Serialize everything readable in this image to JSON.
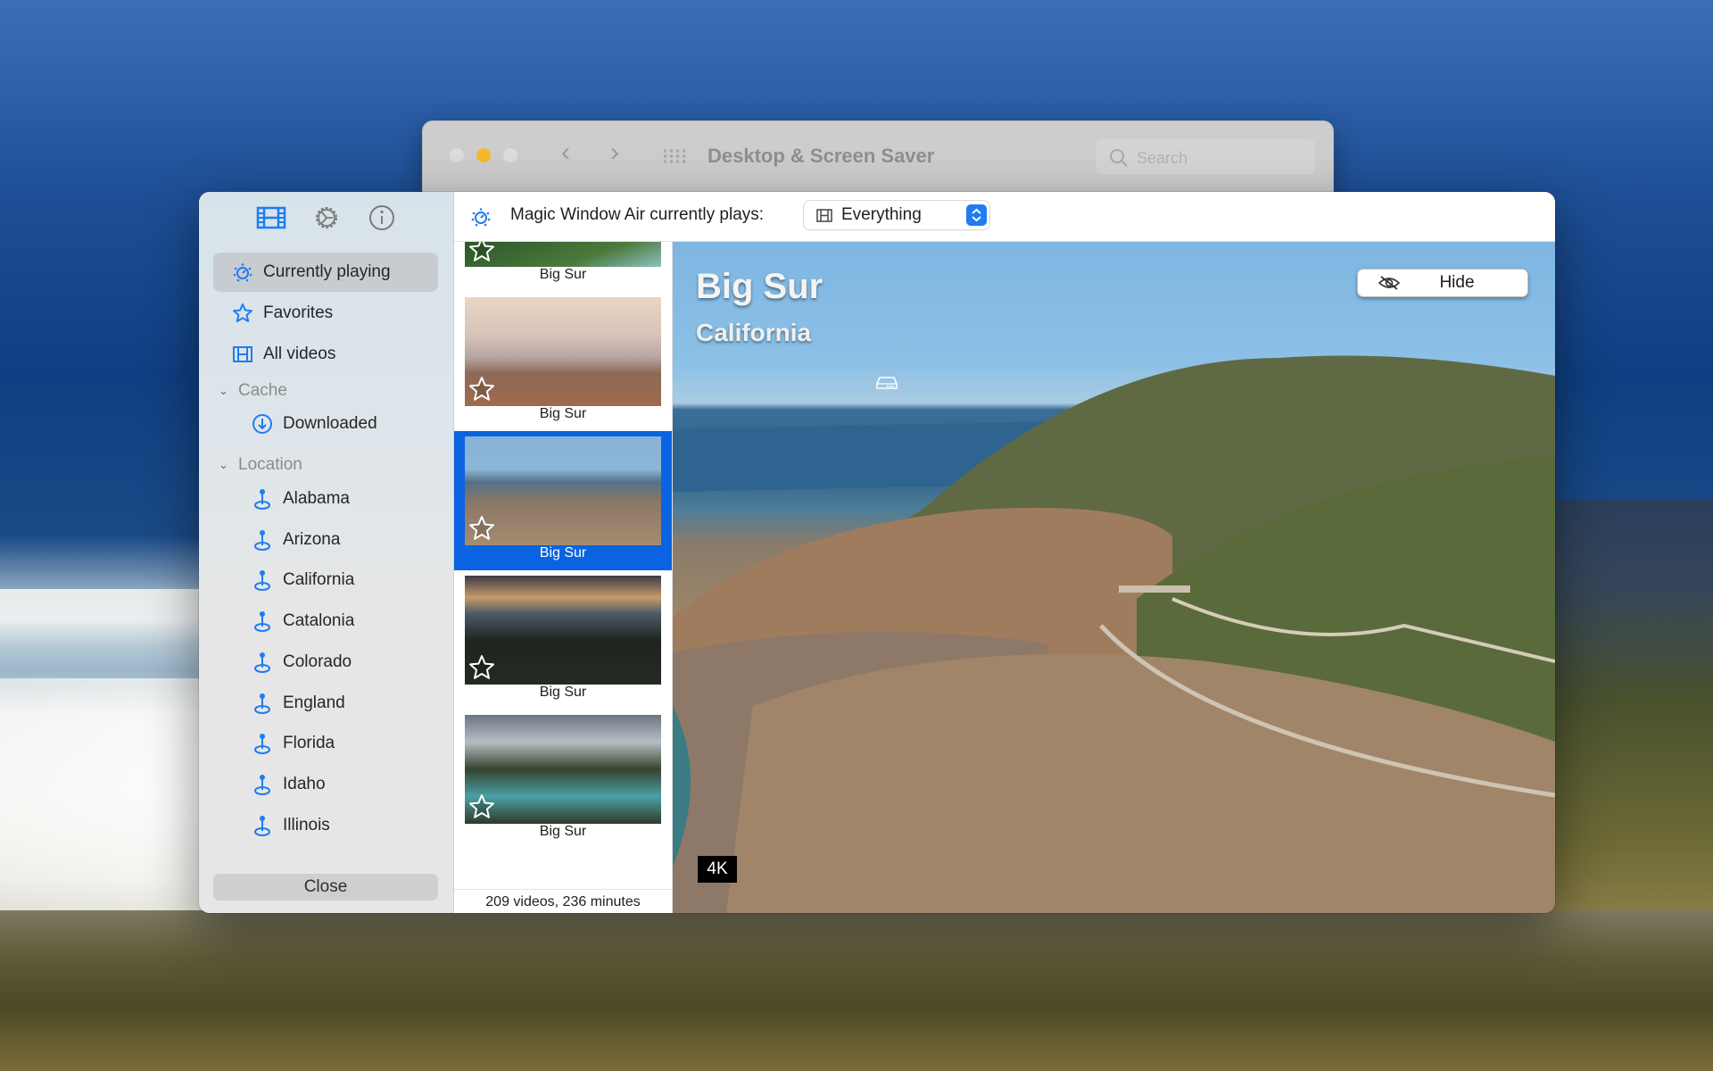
{
  "background_window": {
    "title": "Desktop & Screen Saver",
    "search_placeholder": "Search",
    "traffic_lights": {
      "close": "#dcdcdc",
      "minimize": "#f5b82e",
      "zoom": "#dcdcdc"
    }
  },
  "sidebar": {
    "tabs": [
      {
        "icon": "film-icon",
        "active": true
      },
      {
        "icon": "gear-icon",
        "active": false
      },
      {
        "icon": "info-icon",
        "active": false
      }
    ],
    "items": [
      {
        "label": "Currently playing",
        "icon": "currently-playing-icon",
        "selected": true
      },
      {
        "label": "Favorites",
        "icon": "star-icon"
      },
      {
        "label": "All videos",
        "icon": "film-icon"
      }
    ],
    "cache": {
      "header": "Cache",
      "items": [
        {
          "label": "Downloaded",
          "icon": "download-icon"
        }
      ]
    },
    "location": {
      "header": "Location",
      "items": [
        {
          "label": "Alabama"
        },
        {
          "label": "Arizona"
        },
        {
          "label": "California"
        },
        {
          "label": "Catalonia"
        },
        {
          "label": "Colorado"
        },
        {
          "label": "England"
        },
        {
          "label": "Florida"
        },
        {
          "label": "Idaho"
        },
        {
          "label": "Illinois"
        }
      ]
    },
    "close_label": "Close"
  },
  "header": {
    "label": "Magic Window Air currently plays:",
    "selection": "Everything"
  },
  "thumbnails": [
    {
      "caption": "Big Sur",
      "selected": false
    },
    {
      "caption": "Big Sur",
      "selected": false
    },
    {
      "caption": "Big Sur",
      "selected": true
    },
    {
      "caption": "Big Sur",
      "selected": false
    },
    {
      "caption": "Big Sur",
      "selected": false
    }
  ],
  "strip_footer": "209 videos, 236 minutes",
  "video": {
    "title": "Big Sur",
    "subtitle": "California",
    "hide_label": "Hide",
    "quality_badge": "4K"
  },
  "colors": {
    "accent": "#1f7cf2",
    "selection": "#0a63e0"
  }
}
